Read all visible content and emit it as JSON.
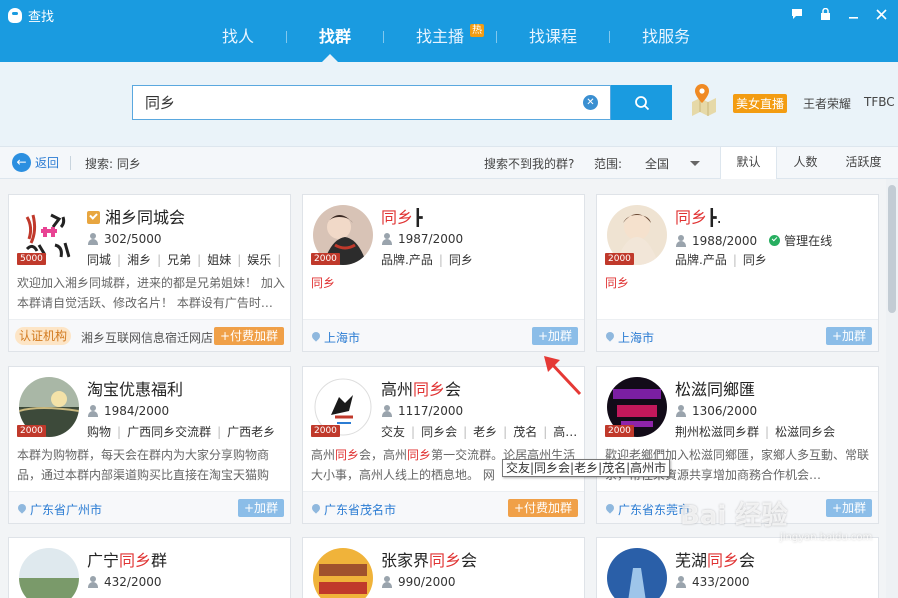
{
  "window": {
    "title": "查找"
  },
  "nav": {
    "tabs": [
      {
        "label": "找人"
      },
      {
        "label": "找群"
      },
      {
        "label": "找主播",
        "badge": "热"
      },
      {
        "label": "找课程"
      },
      {
        "label": "找服务"
      }
    ],
    "active": 1
  },
  "search": {
    "value": "同乡"
  },
  "promo": {
    "live_badge": "美女直播",
    "links": [
      "王者荣耀",
      "TFBC"
    ]
  },
  "filter": {
    "back_label": "返回",
    "search_label": "搜索: 同乡",
    "not_found": "搜索不到我的群?",
    "range_label": "范围:",
    "range_value": "全国",
    "sort": [
      "默认",
      "人数",
      "活跃度"
    ]
  },
  "colors": {
    "brand": "#1a9be0",
    "highlight": "#e03333",
    "join": "#8bbde8",
    "paid": "#f0a048"
  },
  "cards": [
    {
      "name_pre": "",
      "name_hl": "",
      "name_post": "湘乡同城会",
      "members": "302/5000",
      "level": "5000",
      "tags": [
        "同城",
        "湘乡",
        "兄弟",
        "姐妹",
        "娱乐",
        "…"
      ],
      "desc": "欢迎加入湘乡同城群，进来的都是兄弟姐妹！ 加入本群请自觉活跃、修改名片！ 本群设有广告时…",
      "cert": "认证机构",
      "org": "湘乡互联网信息宿迁网店",
      "action": "+付费加群"
    },
    {
      "name_pre": "",
      "name_hl": "同乡",
      "name_post": "┣",
      "members": "1987/2000",
      "level": "2000",
      "tags": [
        "品牌.产品",
        "同乡"
      ],
      "desc_hl": "同乡",
      "location": "上海市",
      "action": "+加群"
    },
    {
      "name_pre": "",
      "name_hl": "同乡",
      "name_post": "┣.",
      "members": "1988/2000",
      "admin": "管理在线",
      "level": "2000",
      "tags": [
        "品牌.产品",
        "同乡"
      ],
      "desc_hl": "同乡",
      "location": "上海市",
      "action": "+加群"
    },
    {
      "name_pre": "淘宝优惠福利",
      "name_hl": "",
      "name_post": "",
      "members": "1984/2000",
      "level": "2000",
      "tags": [
        "购物",
        "广西同乡交流群",
        "广西老乡"
      ],
      "desc": "本群为购物群，每天会在群内为大家分享购物商品，通过本群内部渠道购买比直接在淘宝天猫购买…",
      "location": "广东省广州市",
      "action": "+加群"
    },
    {
      "name_pre": "高州",
      "name_hl": "同乡",
      "name_post": "会",
      "members": "1117/2000",
      "level": "2000",
      "tags": [
        "交友",
        "同乡会",
        "老乡",
        "茂名",
        "高…"
      ],
      "desc_parts": [
        "高州",
        "同乡",
        "会，高州",
        "同乡",
        "第一交流群。论居高州生活大小事，高州人线上的栖息地。 网"
      ],
      "location": "广东省茂名市",
      "action": "+付费加群"
    },
    {
      "name_pre": "松滋同鄉匯",
      "name_hl": "",
      "name_post": "",
      "members": "1306/2000",
      "level": "2000",
      "tags": [
        "荆州松滋同乡群",
        "松滋同乡会"
      ],
      "desc": "歡迎老鄉們加入松滋同鄉匯，家鄉人多互動、常联系，常往來資源共享增加商務合作机会…",
      "location": "广东省东莞市",
      "action": "+加群"
    },
    {
      "name_pre": "广宁",
      "name_hl": "同乡",
      "name_post": "群",
      "members": "432/2000"
    },
    {
      "name_pre": "张家界",
      "name_hl": "同乡",
      "name_post": "会",
      "members": "990/2000"
    },
    {
      "name_pre": "芜湖",
      "name_hl": "同乡",
      "name_post": "会",
      "members": "433/2000"
    }
  ],
  "tooltip": "交友|同乡会|老乡|茂名|高州市",
  "watermark": {
    "main": "Bai 经验",
    "sub": "jingyan.baidu.com"
  }
}
